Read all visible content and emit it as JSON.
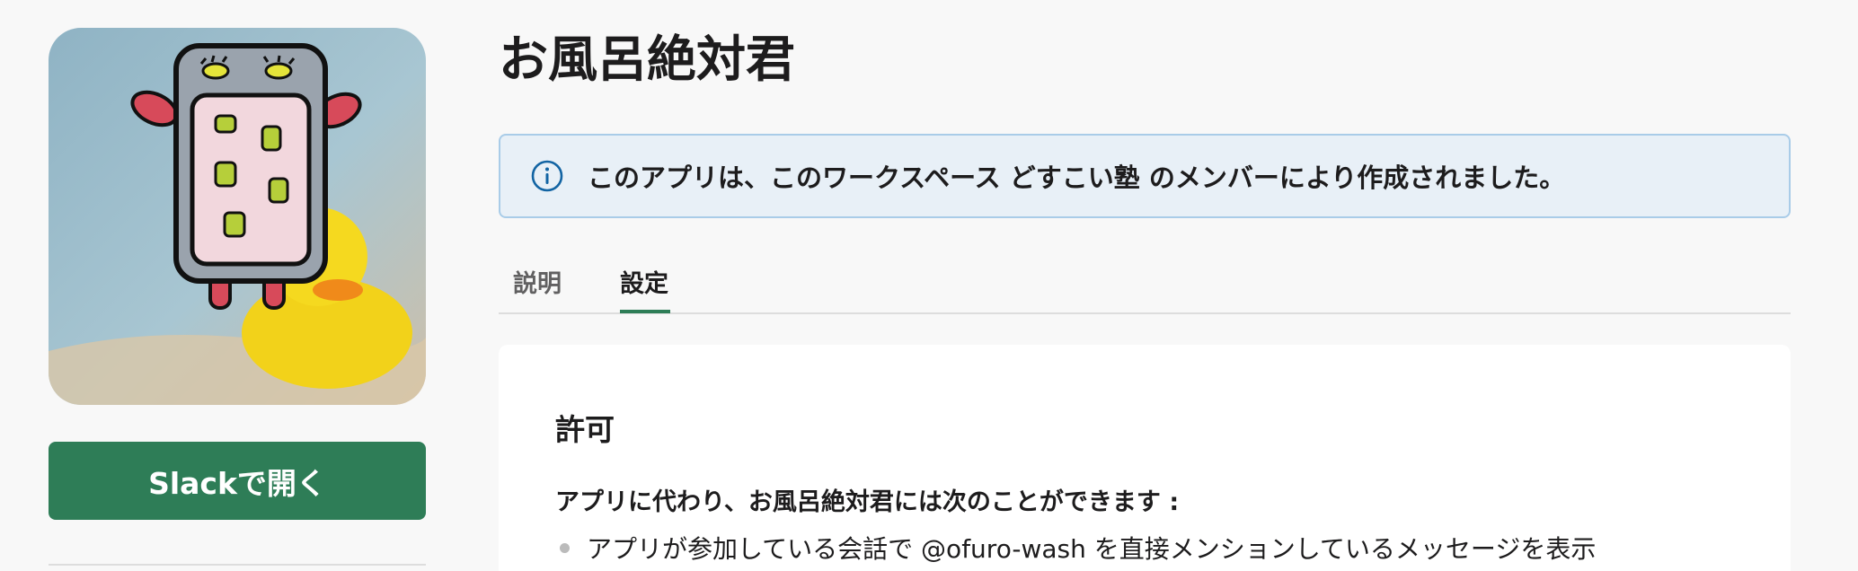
{
  "app": {
    "title": "お風呂絶対君",
    "open_button": "Slackで開く"
  },
  "notice": {
    "icon": "info-icon",
    "text": "このアプリは、このワークスペース どすこい塾 のメンバーにより作成されました。"
  },
  "tabs": [
    {
      "label": "説明",
      "active": false
    },
    {
      "label": "設定",
      "active": true
    }
  ],
  "permissions": {
    "title": "許可",
    "subtitle": "アプリに代わり、お風呂絶対君には次のことができます :",
    "items": [
      "アプリが参加している会話で @ofuro-wash を直接メンションしているメッセージを表示"
    ]
  },
  "colors": {
    "accent": "#2e7d57",
    "notice_bg": "#e8f0f7",
    "notice_border": "#a9cce8",
    "info_icon": "#1264a3"
  }
}
